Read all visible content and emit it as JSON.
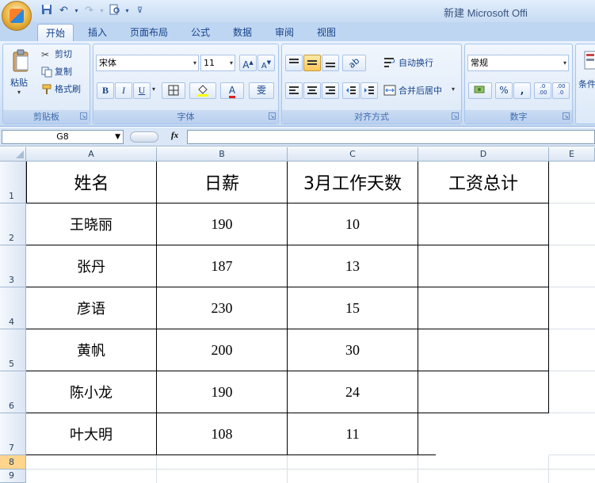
{
  "window": {
    "title": "新建 Microsoft Offi"
  },
  "quick_access": {
    "icons": [
      "save-icon",
      "undo-icon",
      "redo-icon",
      "print-preview-icon",
      "customize-icon"
    ]
  },
  "tabs": [
    "开始",
    "插入",
    "页面布局",
    "公式",
    "数据",
    "审阅",
    "视图"
  ],
  "active_tab": "开始",
  "ribbon": {
    "clipboard": {
      "label": "剪贴板",
      "paste": "粘贴",
      "cut": "剪切",
      "copy": "复制",
      "format_painter": "格式刷"
    },
    "font": {
      "label": "字体",
      "font_name": "宋体",
      "font_size": "11",
      "bold": "B",
      "italic": "I",
      "underline": "U",
      "font_color_glyph": "A",
      "phonetic_glyph": "雯"
    },
    "alignment": {
      "label": "对齐方式",
      "wrap_text": "自动换行",
      "merge_center": "合并后居中"
    },
    "number": {
      "label": "数字",
      "format": "常规",
      "percent": "%",
      "comma": ",",
      "inc_decimal": ".0\n.00",
      "dec_decimal": ".00\n.0"
    },
    "styles": {
      "label_partial": "条件"
    }
  },
  "formula_bar": {
    "name_box": "G8",
    "fx": "fx",
    "formula": ""
  },
  "columns": [
    "A",
    "B",
    "C",
    "D",
    "E"
  ],
  "rows": [
    "1",
    "2",
    "3",
    "4",
    "5",
    "6",
    "7",
    "8",
    "9"
  ],
  "selected_row": "8",
  "table": {
    "headers": [
      "姓名",
      "日薪",
      "3月工作天数",
      "工资总计"
    ],
    "rows": [
      [
        "王晓丽",
        "190",
        "10",
        ""
      ],
      [
        "张丹",
        "187",
        "13",
        ""
      ],
      [
        "彦语",
        "230",
        "15",
        ""
      ],
      [
        "黄帆",
        "200",
        "30",
        ""
      ],
      [
        "陈小龙",
        "190",
        "24",
        ""
      ],
      [
        "叶大明",
        "108",
        "11",
        ""
      ]
    ]
  }
}
